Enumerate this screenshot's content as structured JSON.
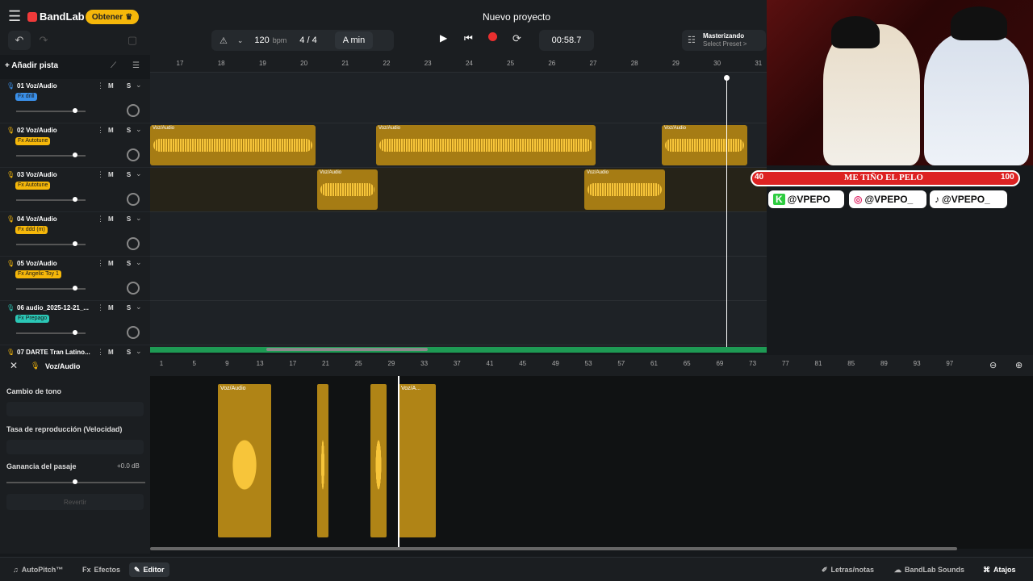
{
  "header": {
    "logo": "BandLab",
    "get_button": "Obtener",
    "project_title": "Nuevo proyecto",
    "bpm": "120",
    "bpm_unit": "bpm",
    "time_signature": "4 / 4",
    "key": "A min",
    "timecode": "00:58.7",
    "master_title": "Masterizando",
    "master_sub": "Select Preset >"
  },
  "add_track": "Añadir pista",
  "ruler_top": [
    "17",
    "18",
    "19",
    "20",
    "21",
    "22",
    "23",
    "24",
    "25",
    "26",
    "27",
    "28",
    "29",
    "30",
    "31"
  ],
  "tracks": [
    {
      "num": "01",
      "name": "Voz/Audio",
      "fx": "Fx drill",
      "fx_color": "#3a8fe8",
      "mic": "#3a8fe8",
      "vol": 0.85
    },
    {
      "num": "02",
      "name": "Voz/Audio",
      "fx": "Fx Autotune",
      "fx_color": "#f5b70a",
      "mic": "#f5b70a",
      "vol": 0.85
    },
    {
      "num": "03",
      "name": "Voz/Audio",
      "fx": "Fx Autotune",
      "fx_color": "#f5b70a",
      "mic": "#f5b70a",
      "vol": 0.85
    },
    {
      "num": "04",
      "name": "Voz/Audio",
      "fx": "Fx ddd (m)",
      "fx_color": "#f5b70a",
      "mic": "#f5b70a",
      "vol": 0.85
    },
    {
      "num": "05",
      "name": "Voz/Audio",
      "fx": "Fx Angelic Toy 1",
      "fx_color": "#f5b70a",
      "mic": "#f5b70a",
      "vol": 0.85
    },
    {
      "num": "06",
      "name": "audio_2025-12-21_...",
      "fx": "Fx Prepago",
      "fx_color": "#2bc7b6",
      "mic": "#2bc7b6",
      "vol": 0.85
    },
    {
      "num": "07",
      "name": "DARTE Tran Latino...",
      "fx": "",
      "fx_color": "#f5b70a",
      "mic": "#f5b70a",
      "vol": 0.85
    }
  ],
  "mute_solo": "M S",
  "clip_label": "Voz/Audio",
  "editor": {
    "title": "Voz/Audio",
    "pitch_label": "Cambio de tono",
    "rate_label": "Tasa de reproducción (Velocidad)",
    "gain_label": "Ganancia del pasaje",
    "gain_value": "+0.0 dB",
    "revert": "Revertir",
    "ruler": [
      "1",
      "5",
      "9",
      "13",
      "17",
      "21",
      "25",
      "29",
      "33",
      "37",
      "41",
      "45",
      "49",
      "53",
      "57",
      "61",
      "65",
      "69",
      "73",
      "77",
      "81",
      "85",
      "89",
      "93",
      "97"
    ],
    "clip_labels": [
      "Voz/Audio",
      "Voz/A..."
    ]
  },
  "bottom": {
    "autopitch": "AutoPitch™",
    "effects": "Efectos",
    "editor": "Editor",
    "lyrics": "Letras/notas",
    "sounds": "BandLab Sounds",
    "shortcuts": "Atajos"
  },
  "stream": {
    "left_num": "40",
    "title": "ME TIÑO EL PELO",
    "right_num": "100",
    "socials": [
      "@VPEPO",
      "@VPEPO_",
      "@VPEPO_"
    ]
  },
  "colors": {
    "accent": "#f5b70a",
    "clip": "#a67c14",
    "record": "#e82f2f",
    "scroll": "#1e9a54"
  }
}
